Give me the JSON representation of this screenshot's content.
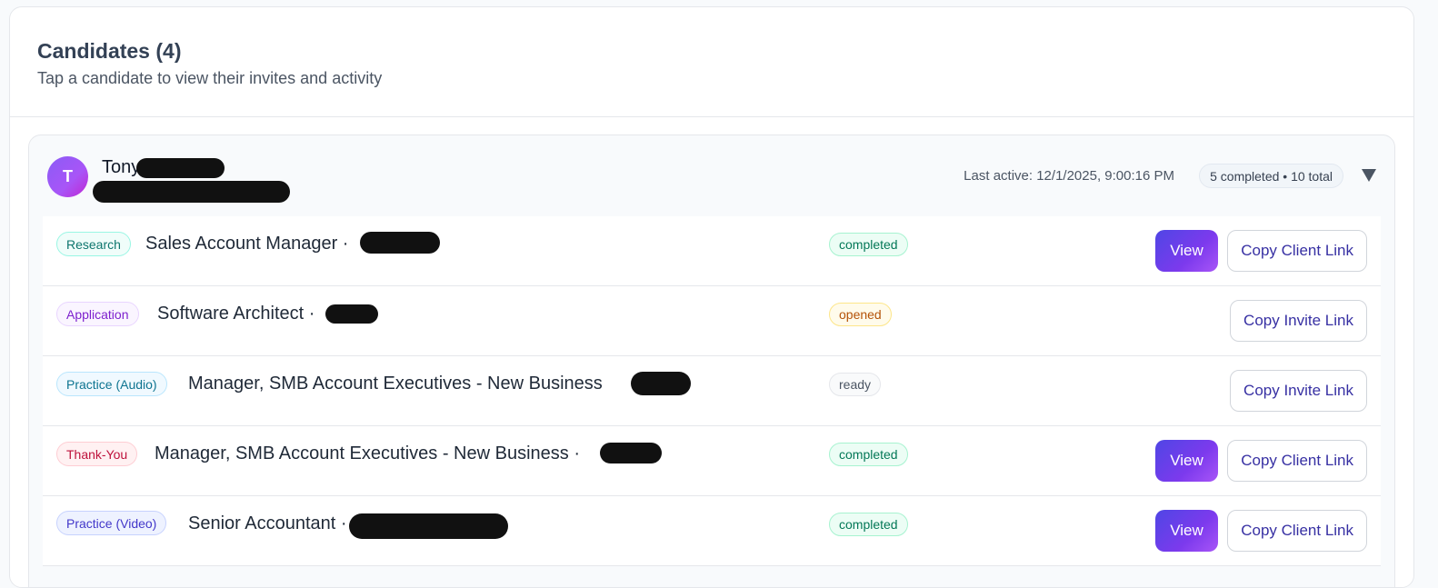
{
  "header": {
    "title": "Candidates (4)",
    "subtitle": "Tap a candidate to view their invites and activity"
  },
  "candidate": {
    "avatar_initial": "T",
    "name": "Tony",
    "last_active": "Last active: 12/1/2025, 9:00:16 PM",
    "totals": "5 completed • 10 total",
    "toggle_icon": "triangle-down-icon"
  },
  "invites": [
    {
      "type": "Research",
      "title": "Sales Account Manager ·",
      "status": "completed",
      "view_label": "View",
      "copy_label": "Copy Client Link"
    },
    {
      "type": "Application",
      "title": "Software Architect ·",
      "status": "opened",
      "view_label": "",
      "copy_label": "Copy Invite Link"
    },
    {
      "type": "Practice (Audio)",
      "title": "Manager, SMB Account Executives - New Business",
      "status": "ready",
      "view_label": "",
      "copy_label": "Copy Invite Link"
    },
    {
      "type": "Thank-You",
      "title": "Manager, SMB Account Executives - New Business ·",
      "status": "completed",
      "view_label": "View",
      "copy_label": "Copy Client Link"
    },
    {
      "type": "Practice (Video)",
      "title": "Senior Accountant ·",
      "status": "completed",
      "view_label": "View",
      "copy_label": "Copy Client Link"
    }
  ],
  "colors": {
    "accent": "#6d28d9",
    "completed": "#047857",
    "opened": "#b45309",
    "ready": "#4b5563"
  }
}
